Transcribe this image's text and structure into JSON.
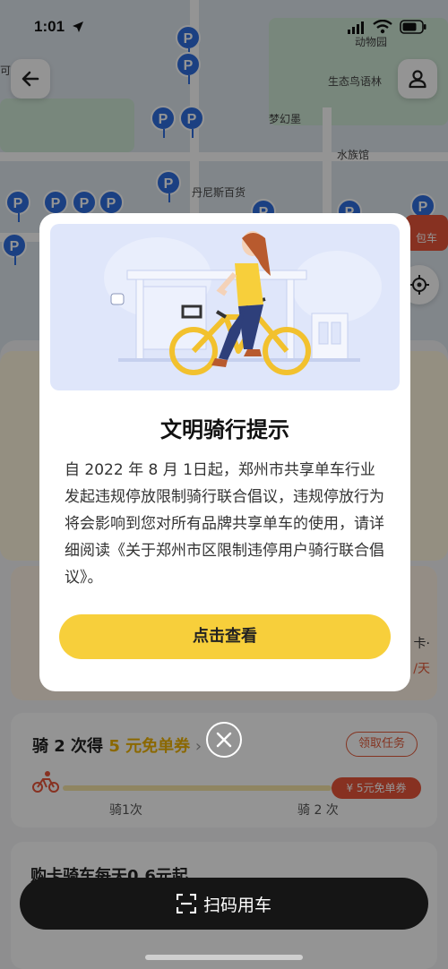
{
  "status_bar": {
    "time": "1:01"
  },
  "map": {
    "labels": {
      "zoo": "动物园",
      "scenic": "生态鸟语林",
      "dream": "梦幻墨",
      "lake": "水族馆",
      "street": "丹尼斯百货",
      "left_area": "可口·农业",
      "pin_letter": "P"
    },
    "red_envelope": "包车"
  },
  "panel": {
    "ride_task": {
      "prefix": "骑 2 次得 ",
      "highlight": "5 元免单券",
      "suffix": " ›"
    },
    "task_button": "领取任务",
    "progress_start": "骑1次",
    "progress_end": "骑 2 次",
    "coupon_badge": "¥ 5元免单券",
    "promo": "购卡骑车每天0.6元起",
    "side_card_text": "卡·",
    "side_card_price": "/天"
  },
  "modal": {
    "title": "文明骑行提示",
    "body": "自 2022 年 8 月 1日起，郑州市共享单车行业发起违规停放限制骑行联合倡议，违规停放行为将会影响到您对所有品牌共享单车的使用，请详细阅读《关于郑州市区限制违停用户骑行联合倡议》。",
    "action": "点击查看"
  },
  "scan_bar": {
    "label": "扫码用车"
  },
  "colors": {
    "accent_yellow": "#f7cf3b",
    "task_red": "#e45a3a",
    "pin_blue": "#2f6fe0",
    "illustration_bg": "#dfe6fa"
  },
  "icons": {
    "back": "back-arrow-icon",
    "profile": "user-icon",
    "locate": "locate-icon",
    "close": "close-icon",
    "scan": "scan-icon",
    "cyclist": "cyclist-icon"
  }
}
